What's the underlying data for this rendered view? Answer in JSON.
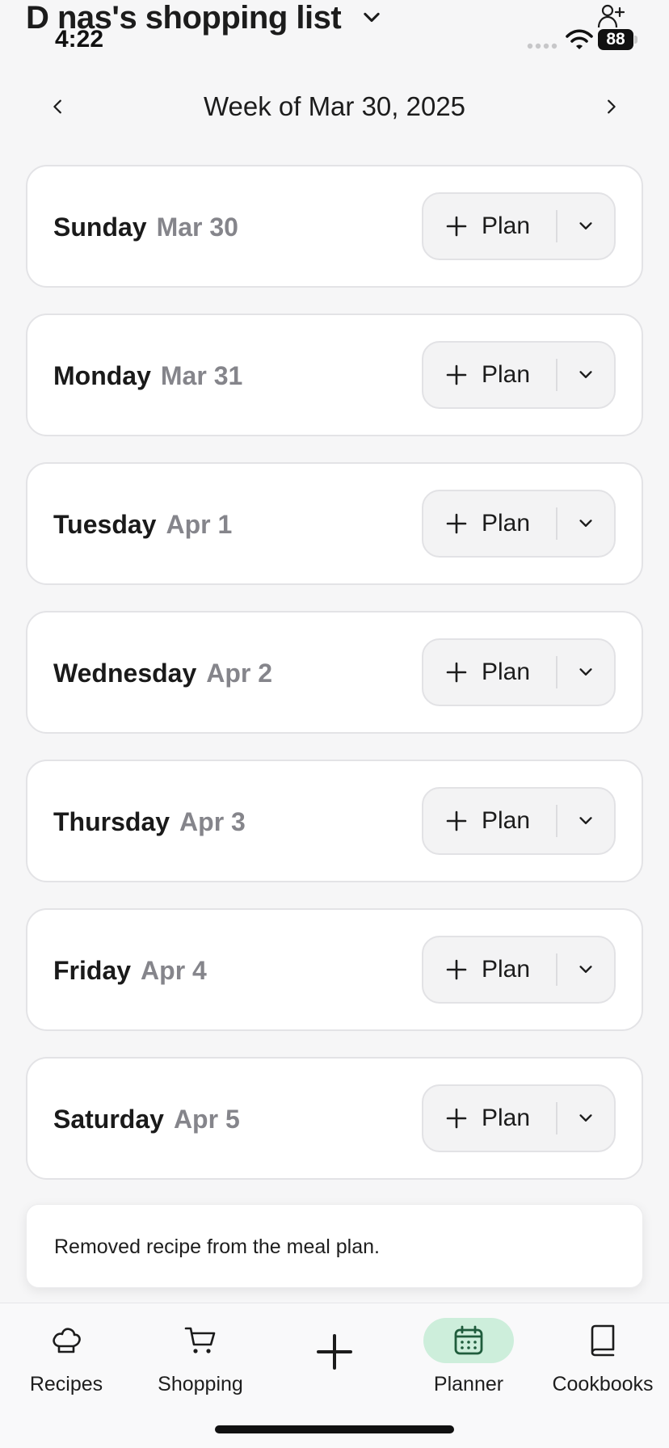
{
  "header": {
    "title": "D nas's shopping list",
    "time": "4:22",
    "battery": "88"
  },
  "week_nav": {
    "label": "Week of Mar 30, 2025"
  },
  "days": [
    {
      "name": "Sunday",
      "date": "Mar 30",
      "plan_label": "Plan"
    },
    {
      "name": "Monday",
      "date": "Mar 31",
      "plan_label": "Plan"
    },
    {
      "name": "Tuesday",
      "date": "Apr 1",
      "plan_label": "Plan"
    },
    {
      "name": "Wednesday",
      "date": "Apr 2",
      "plan_label": "Plan"
    },
    {
      "name": "Thursday",
      "date": "Apr 3",
      "plan_label": "Plan"
    },
    {
      "name": "Friday",
      "date": "Apr 4",
      "plan_label": "Plan"
    },
    {
      "name": "Saturday",
      "date": "Apr 5",
      "plan_label": "Plan"
    }
  ],
  "toast": {
    "message": "Removed recipe from the meal plan."
  },
  "tab_bar": {
    "tabs": [
      {
        "label": "Recipes",
        "icon": "chef-hat-icon"
      },
      {
        "label": "Shopping",
        "icon": "cart-icon"
      },
      {
        "label": "",
        "icon": "plus-icon"
      },
      {
        "label": "Planner",
        "icon": "calendar-icon",
        "active": true
      },
      {
        "label": "Cookbooks",
        "icon": "book-icon"
      }
    ]
  },
  "colors": {
    "background": "#f6f6f7",
    "card": "#ffffff",
    "active_tab_pill": "#cdeedb",
    "active_tab_icon": "#1f5c3c",
    "muted_text": "#85858b"
  }
}
